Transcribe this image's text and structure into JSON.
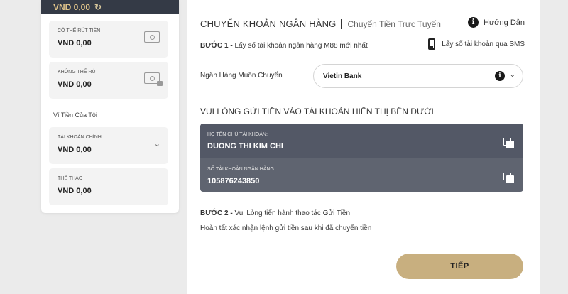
{
  "wallet": {
    "balance": "VND  0,00",
    "refresh_icon": "refresh-icon",
    "withdrawable": {
      "label": "Có thể rút tiền",
      "amount": "VND  0,00",
      "icon": "cash-icon"
    },
    "non_withdrawable": {
      "label": "Không thể rút",
      "amount": "VND  0,00",
      "icon": "cash-locked-icon"
    },
    "my_wallet_title": "Ví Tiền Của Tôi",
    "main_account": {
      "label": "Tài khoản chính",
      "amount": "VND  0,00",
      "icon": "chevron-down-icon"
    },
    "sports": {
      "label": "Thể thao",
      "amount": "VND  0,00"
    }
  },
  "transfer": {
    "title": "Chuyển Khoản Ngân Hàng",
    "subtitle": "Chuyển Tiền Trực Tuyến",
    "guide_label": "Hướng Dẫn",
    "step1_prefix": "BƯỚC 1 -",
    "step1_text": "Lấy số tài khoản ngân hàng M88 mới nhất",
    "sms_label": "Lấy số tài khoản qua SMS",
    "bank_label": "Ngân Hàng Muốn Chuyển",
    "bank_selected": "Vietin Bank",
    "deposit_heading": "Vui lòng gửi tiền vào tài khoản hiển thị bên dưới",
    "account_holder_label": "Họ tên chủ tài khoản:",
    "account_holder_value": "DUONG THI KIM CHI",
    "account_number_label": "Số tài khoản ngân hàng:",
    "account_number_value": "105876243850",
    "step2_prefix": "BƯỚC 2 -",
    "step2_text": "Vui Lòng tiến hành thao tác Gửi Tiền",
    "confirm_note": "Hoàn tất xác nhận lệnh gửi tiền sau khi đã chuyển tiền",
    "next_label": "TIẾP"
  },
  "colors": {
    "accent_gold": "#c8af7f",
    "dark_bar": "#343a46",
    "account_box": "#535866"
  }
}
